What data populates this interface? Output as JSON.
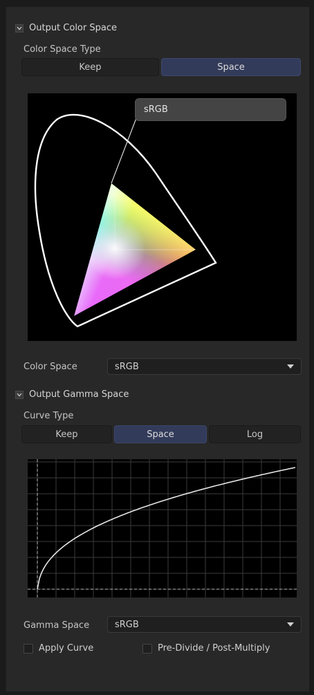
{
  "output_color_space": {
    "section_label": "Output Color Space",
    "type_label": "Color Space Type",
    "type_buttons": [
      "Keep",
      "Space"
    ],
    "active_type": "Space",
    "chromaticity_tag": "sRGB",
    "color_space_label": "Color Space",
    "color_space_value": "sRGB"
  },
  "output_gamma_space": {
    "section_label": "Output Gamma Space",
    "curve_type_label": "Curve Type",
    "curve_buttons": [
      "Keep",
      "Space",
      "Log"
    ],
    "active_curve": "Space",
    "gamma_space_label": "Gamma Space",
    "gamma_space_value": "sRGB"
  },
  "options": {
    "apply_curve_label": "Apply Curve",
    "apply_curve_checked": false,
    "predivide_label": "Pre-Divide / Post-Multiply",
    "predivide_checked": false
  },
  "colors": {
    "panel_bg": "#282828",
    "active_button": "#323b5a",
    "plot_bg": "#000000"
  },
  "icons": {
    "section_toggle": "chevron-down-icon",
    "dropdown": "caret-down-icon"
  }
}
